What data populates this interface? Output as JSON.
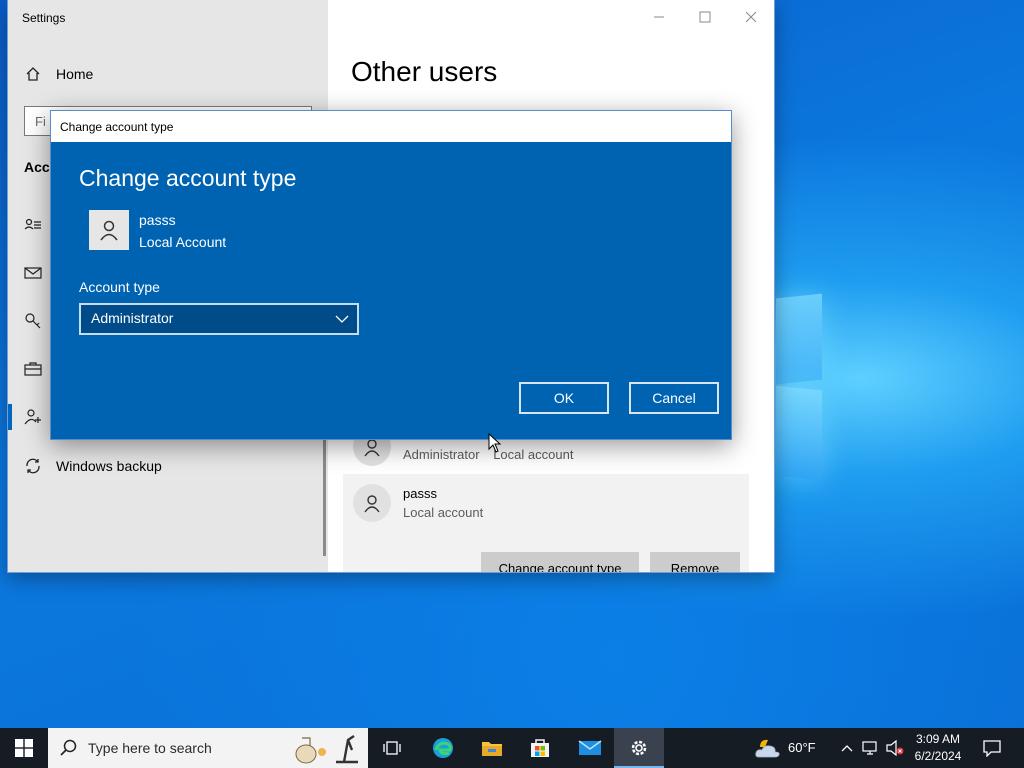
{
  "settings": {
    "title": "Settings",
    "nav_home": "Home",
    "search_placeholder": "Fi",
    "section_header": "Acco",
    "nav_windows_backup": "Windows backup",
    "page_title": "Other users",
    "users": [
      {
        "name": "Administrator",
        "type": "Local account"
      },
      {
        "name": "passs",
        "type": "Local account"
      }
    ],
    "buttons": {
      "change_account_type": "Change account type",
      "remove": "Remove"
    }
  },
  "dialog": {
    "window_title": "Change account type",
    "heading": "Change account type",
    "user_name": "passs",
    "user_type": "Local Account",
    "account_type_label": "Account type",
    "account_type_value": "Administrator",
    "ok_label": "OK",
    "cancel_label": "Cancel"
  },
  "taskbar": {
    "search_placeholder": "Type here to search",
    "weather": "60°F",
    "time": "3:09 AM",
    "date": "6/2/2024"
  },
  "icons": {
    "start": "windows-logo-icon",
    "search": "search-icon",
    "task_view": "task-view-icon",
    "edge": "edge-icon",
    "explorer": "file-explorer-icon",
    "store": "store-icon",
    "mail": "mail-icon",
    "settings": "gear-icon",
    "weather": "weather-icon",
    "notifications": "notification-icon"
  },
  "colors": {
    "dialog_bg": "#0063b1",
    "taskbar_bg": "#161c24",
    "accent": "#0067c0"
  }
}
